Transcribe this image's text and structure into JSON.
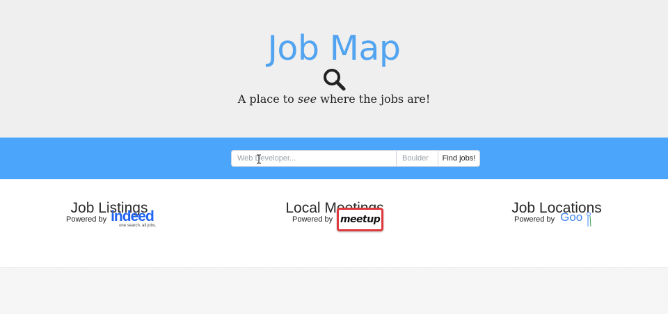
{
  "hero": {
    "title": "Job Map",
    "tagline_before": "A place to ",
    "tagline_emphasis": "see",
    "tagline_after": " where the jobs are!",
    "icon": "search-icon"
  },
  "search": {
    "query_placeholder": "Web Developer...",
    "location_placeholder": "Boulder",
    "button_label": "Find jobs!"
  },
  "features": [
    {
      "title": "Job Listings",
      "powered_label": "Powered by",
      "provider": "indeed",
      "provider_tagline": "one search. all jobs."
    },
    {
      "title": "Local Meetings",
      "powered_label": "Powered by",
      "provider": "meetup"
    },
    {
      "title": "Job Locations",
      "powered_label": "Powered by",
      "provider": "Goo"
    }
  ],
  "colors": {
    "hero_background": "#efefef",
    "title": "#52a4f0",
    "search_band": "#4ba5fb",
    "indeed_blue": "#2164f3",
    "meetup_red": "#e0393e"
  }
}
